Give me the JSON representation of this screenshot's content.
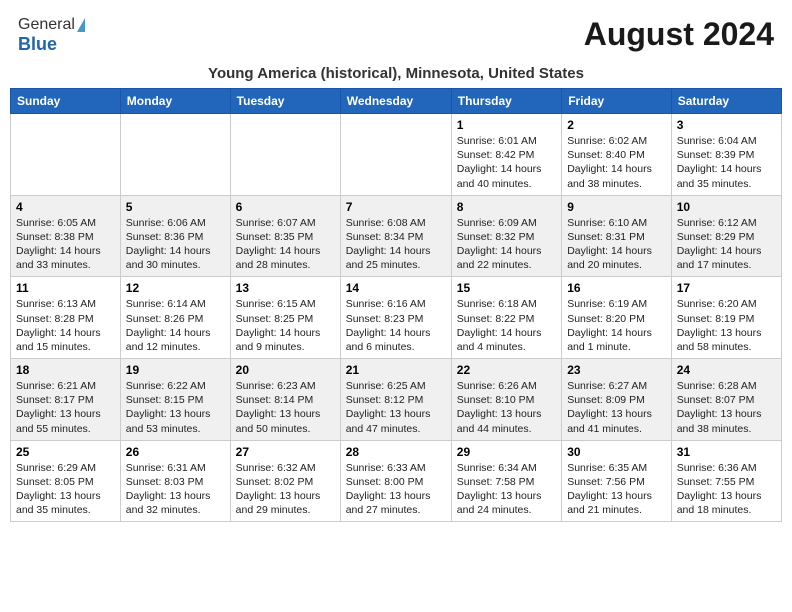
{
  "header": {
    "logo_general": "General",
    "logo_blue": "Blue",
    "month_title": "August 2024",
    "location": "Young America (historical), Minnesota, United States"
  },
  "weekdays": [
    "Sunday",
    "Monday",
    "Tuesday",
    "Wednesday",
    "Thursday",
    "Friday",
    "Saturday"
  ],
  "weeks": [
    [
      {
        "day": "",
        "info": ""
      },
      {
        "day": "",
        "info": ""
      },
      {
        "day": "",
        "info": ""
      },
      {
        "day": "",
        "info": ""
      },
      {
        "day": "1",
        "info": "Sunrise: 6:01 AM\nSunset: 8:42 PM\nDaylight: 14 hours\nand 40 minutes."
      },
      {
        "day": "2",
        "info": "Sunrise: 6:02 AM\nSunset: 8:40 PM\nDaylight: 14 hours\nand 38 minutes."
      },
      {
        "day": "3",
        "info": "Sunrise: 6:04 AM\nSunset: 8:39 PM\nDaylight: 14 hours\nand 35 minutes."
      }
    ],
    [
      {
        "day": "4",
        "info": "Sunrise: 6:05 AM\nSunset: 8:38 PM\nDaylight: 14 hours\nand 33 minutes."
      },
      {
        "day": "5",
        "info": "Sunrise: 6:06 AM\nSunset: 8:36 PM\nDaylight: 14 hours\nand 30 minutes."
      },
      {
        "day": "6",
        "info": "Sunrise: 6:07 AM\nSunset: 8:35 PM\nDaylight: 14 hours\nand 28 minutes."
      },
      {
        "day": "7",
        "info": "Sunrise: 6:08 AM\nSunset: 8:34 PM\nDaylight: 14 hours\nand 25 minutes."
      },
      {
        "day": "8",
        "info": "Sunrise: 6:09 AM\nSunset: 8:32 PM\nDaylight: 14 hours\nand 22 minutes."
      },
      {
        "day": "9",
        "info": "Sunrise: 6:10 AM\nSunset: 8:31 PM\nDaylight: 14 hours\nand 20 minutes."
      },
      {
        "day": "10",
        "info": "Sunrise: 6:12 AM\nSunset: 8:29 PM\nDaylight: 14 hours\nand 17 minutes."
      }
    ],
    [
      {
        "day": "11",
        "info": "Sunrise: 6:13 AM\nSunset: 8:28 PM\nDaylight: 14 hours\nand 15 minutes."
      },
      {
        "day": "12",
        "info": "Sunrise: 6:14 AM\nSunset: 8:26 PM\nDaylight: 14 hours\nand 12 minutes."
      },
      {
        "day": "13",
        "info": "Sunrise: 6:15 AM\nSunset: 8:25 PM\nDaylight: 14 hours\nand 9 minutes."
      },
      {
        "day": "14",
        "info": "Sunrise: 6:16 AM\nSunset: 8:23 PM\nDaylight: 14 hours\nand 6 minutes."
      },
      {
        "day": "15",
        "info": "Sunrise: 6:18 AM\nSunset: 8:22 PM\nDaylight: 14 hours\nand 4 minutes."
      },
      {
        "day": "16",
        "info": "Sunrise: 6:19 AM\nSunset: 8:20 PM\nDaylight: 14 hours\nand 1 minute."
      },
      {
        "day": "17",
        "info": "Sunrise: 6:20 AM\nSunset: 8:19 PM\nDaylight: 13 hours\nand 58 minutes."
      }
    ],
    [
      {
        "day": "18",
        "info": "Sunrise: 6:21 AM\nSunset: 8:17 PM\nDaylight: 13 hours\nand 55 minutes."
      },
      {
        "day": "19",
        "info": "Sunrise: 6:22 AM\nSunset: 8:15 PM\nDaylight: 13 hours\nand 53 minutes."
      },
      {
        "day": "20",
        "info": "Sunrise: 6:23 AM\nSunset: 8:14 PM\nDaylight: 13 hours\nand 50 minutes."
      },
      {
        "day": "21",
        "info": "Sunrise: 6:25 AM\nSunset: 8:12 PM\nDaylight: 13 hours\nand 47 minutes."
      },
      {
        "day": "22",
        "info": "Sunrise: 6:26 AM\nSunset: 8:10 PM\nDaylight: 13 hours\nand 44 minutes."
      },
      {
        "day": "23",
        "info": "Sunrise: 6:27 AM\nSunset: 8:09 PM\nDaylight: 13 hours\nand 41 minutes."
      },
      {
        "day": "24",
        "info": "Sunrise: 6:28 AM\nSunset: 8:07 PM\nDaylight: 13 hours\nand 38 minutes."
      }
    ],
    [
      {
        "day": "25",
        "info": "Sunrise: 6:29 AM\nSunset: 8:05 PM\nDaylight: 13 hours\nand 35 minutes."
      },
      {
        "day": "26",
        "info": "Sunrise: 6:31 AM\nSunset: 8:03 PM\nDaylight: 13 hours\nand 32 minutes."
      },
      {
        "day": "27",
        "info": "Sunrise: 6:32 AM\nSunset: 8:02 PM\nDaylight: 13 hours\nand 29 minutes."
      },
      {
        "day": "28",
        "info": "Sunrise: 6:33 AM\nSunset: 8:00 PM\nDaylight: 13 hours\nand 27 minutes."
      },
      {
        "day": "29",
        "info": "Sunrise: 6:34 AM\nSunset: 7:58 PM\nDaylight: 13 hours\nand 24 minutes."
      },
      {
        "day": "30",
        "info": "Sunrise: 6:35 AM\nSunset: 7:56 PM\nDaylight: 13 hours\nand 21 minutes."
      },
      {
        "day": "31",
        "info": "Sunrise: 6:36 AM\nSunset: 7:55 PM\nDaylight: 13 hours\nand 18 minutes."
      }
    ]
  ]
}
